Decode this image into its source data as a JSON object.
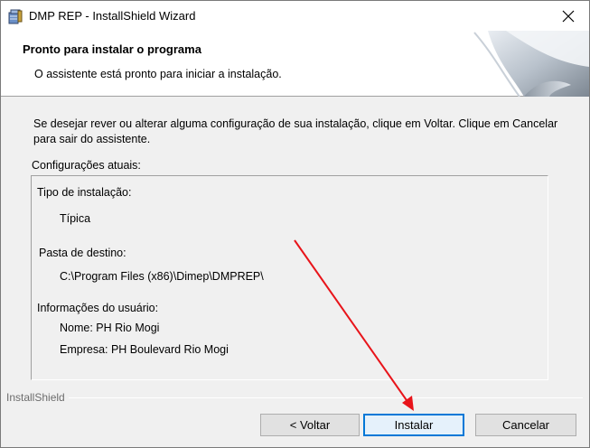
{
  "window": {
    "title": "DMP REP - InstallShield Wizard",
    "close_glyph": "✕",
    "icon": "installer-package-icon"
  },
  "header": {
    "title": "Pronto para instalar o programa",
    "subtitle": "O assistente está pronto para iniciar a instalação.",
    "graphic": "curled-page-graphic"
  },
  "body": {
    "instructions": "Se desejar rever ou alterar alguma configuração de sua instalação, clique em Voltar. Clique em Cancelar para sair do assistente.",
    "settings_label": "Configurações atuais:",
    "settings": {
      "install_type_label": "Tipo de instalação:",
      "install_type_value": "Típica",
      "destination_label": "Pasta de destino:",
      "destination_value": "C:\\Program Files (x86)\\Dimep\\DMPREP\\",
      "user_info_label": "Informações do usuário:",
      "name_line": "Nome: PH Rio Mogi",
      "company_line": "Empresa: PH Boulevard Rio Mogi"
    }
  },
  "footer": {
    "brand": "InstallShield",
    "back_label": "< Voltar",
    "install_label": "Instalar",
    "cancel_label": "Cancelar"
  },
  "colors": {
    "accent": "#0078d7",
    "annotation_arrow": "#e8141a"
  }
}
